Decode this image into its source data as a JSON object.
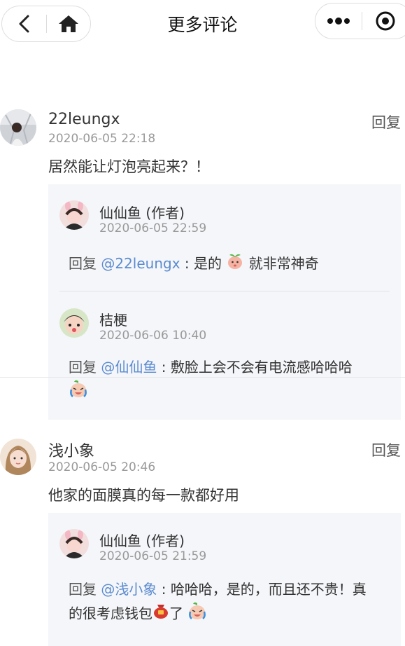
{
  "header": {
    "title": "更多评论"
  },
  "comments": [
    {
      "username": "22leungx",
      "date": "2020-06-05 22:18",
      "reply_label": "回复",
      "text": "居然能让灯泡亮起来？！",
      "replies": [
        {
          "name": "仙仙鱼 (作者)",
          "date": "2020-06-05 22:59",
          "prefix": "回复 ",
          "mention": "@22leungx",
          "text_a": " : 是的 ",
          "text_b": " 就非常神奇"
        },
        {
          "name": "桔梗",
          "date": "2020-06-06 10:40",
          "prefix": "回复 ",
          "mention": "@仙仙鱼",
          "text_a": " : 敷脸上会不会有电流感哈哈哈"
        }
      ]
    },
    {
      "username": "浅小象",
      "date": "2020-06-05 20:46",
      "reply_label": "回复",
      "text": "他家的面膜真的每一款都好用",
      "replies": [
        {
          "name": "仙仙鱼 (作者)",
          "date": "2020-06-05 21:59",
          "prefix": "回复 ",
          "mention": "@浅小象",
          "text_a": " : 哈哈哈，是的，而且还不贵！真",
          "text_b": "的很考虑钱包",
          "text_c": "了 "
        }
      ]
    }
  ]
}
